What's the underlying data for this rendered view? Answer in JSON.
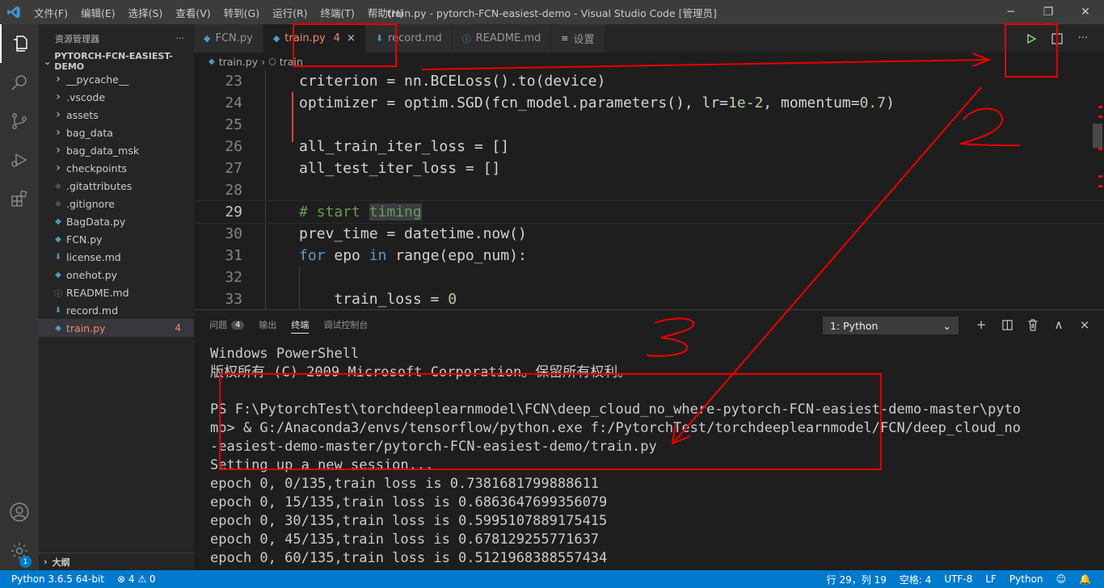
{
  "titlebar": {
    "menu": [
      "文件(F)",
      "编辑(E)",
      "选择(S)",
      "查看(V)",
      "转到(G)",
      "运行(R)",
      "终端(T)",
      "帮助(H)"
    ],
    "window_title": "train.py - pytorch-FCN-easiest-demo - Visual Studio Code [管理员]"
  },
  "activity": {
    "accounts_badge": "1"
  },
  "sidebar": {
    "header": "资源管理器",
    "more": "···",
    "project": "PYTORCH-FCN-EASIEST-DEMO",
    "items": [
      {
        "label": "__pycache__",
        "icon": "chevron-right-icon",
        "glyph": "›",
        "indent": 1
      },
      {
        "label": ".vscode",
        "icon": "chevron-right-icon",
        "glyph": "›",
        "indent": 1
      },
      {
        "label": "assets",
        "icon": "chevron-right-icon",
        "glyph": "›",
        "indent": 1
      },
      {
        "label": "bag_data",
        "icon": "chevron-right-icon",
        "glyph": "›",
        "indent": 1
      },
      {
        "label": "bag_data_msk",
        "icon": "chevron-right-icon",
        "glyph": "›",
        "indent": 1
      },
      {
        "label": "checkpoints",
        "icon": "chevron-right-icon",
        "glyph": "›",
        "indent": 1
      },
      {
        "label": ".gitattributes",
        "icon": "git-file-icon",
        "glyph": "◆",
        "indent": 1
      },
      {
        "label": ".gitignore",
        "icon": "git-file-icon",
        "glyph": "◆",
        "indent": 1
      },
      {
        "label": "BagData.py",
        "icon": "python-file-icon",
        "glyph": "◆",
        "indent": 1
      },
      {
        "label": "FCN.py",
        "icon": "python-file-icon",
        "glyph": "◆",
        "indent": 1
      },
      {
        "label": "license.md",
        "icon": "markdown-file-icon",
        "glyph": "⬇",
        "indent": 1
      },
      {
        "label": "onehot.py",
        "icon": "python-file-icon",
        "glyph": "◆",
        "indent": 1
      },
      {
        "label": "README.md",
        "icon": "info-file-icon",
        "glyph": "ⓘ",
        "indent": 1
      },
      {
        "label": "record.md",
        "icon": "markdown-file-icon",
        "glyph": "⬇",
        "indent": 1
      },
      {
        "label": "train.py",
        "icon": "python-file-icon",
        "glyph": "◆",
        "indent": 1,
        "selected": true,
        "count": "4"
      }
    ],
    "outline": "大纲"
  },
  "tabs": [
    {
      "label": "FCN.py",
      "icon": "python-file-icon",
      "glyph": "◆"
    },
    {
      "label": "train.py",
      "icon": "python-file-icon",
      "glyph": "◆",
      "active": true,
      "badge": "4",
      "close": "×"
    },
    {
      "label": "record.md",
      "icon": "markdown-file-icon",
      "glyph": "⬇"
    },
    {
      "label": "README.md",
      "icon": "info-file-icon",
      "glyph": "ⓘ"
    },
    {
      "label": "设置",
      "icon": "settings-file-icon",
      "glyph": "≡"
    }
  ],
  "tab_actions": {
    "run": "▷",
    "split": "◫",
    "more": "···"
  },
  "breadcrumb": {
    "file": "train.py",
    "symbol": "train"
  },
  "code": {
    "lines": [
      {
        "n": "23",
        "html": "criterion = nn.BCELoss().to(device)"
      },
      {
        "n": "24",
        "html": "optimizer = optim.SGD(fcn_model.parameters(), lr=<span class=\"num\">1e-2</span>, momentum=<span class=\"num\">0.7</span>)"
      },
      {
        "n": "25",
        "html": ""
      },
      {
        "n": "26",
        "html": "all_train_iter_loss = []"
      },
      {
        "n": "27",
        "html": "all_test_iter_loss = []"
      },
      {
        "n": "28",
        "html": ""
      },
      {
        "n": "29",
        "html": "<span class=\"cm\"># start <span class=\"hl\">timing</span></span>",
        "current": true
      },
      {
        "n": "30",
        "html": "prev_time = datetime.now()"
      },
      {
        "n": "31",
        "html": "<span class=\"kw\">for</span> epo <span class=\"kw\">in</span> range(epo_num):"
      },
      {
        "n": "32",
        "html": ""
      },
      {
        "n": "33",
        "html": "    train_loss = <span class=\"num\">0</span>"
      }
    ]
  },
  "panel": {
    "tabs": [
      {
        "label": "问题",
        "badge": "4"
      },
      {
        "label": "输出"
      },
      {
        "label": "终端",
        "active": true
      },
      {
        "label": "调试控制台"
      }
    ],
    "terminal_select": "1: Python",
    "actions": {
      "add": "+",
      "split": "◫",
      "trash": "🗑",
      "maximize": "∧",
      "close": "×"
    },
    "terminal_lines": [
      "Windows PowerShell",
      "版权所有 (C) 2009 Microsoft Corporation。保留所有权利。",
      "",
      "PS F:\\PytorchTest\\torchdeeplearnmodel\\FCN\\deep_cloud_no_where-pytorch-FCN-easiest-demo-master\\pyto",
      "mo> & G:/Anaconda3/envs/tensorflow/python.exe f:/PytorchTest/torchdeeplearnmodel/FCN/deep_cloud_no",
      "-easiest-demo-master/pytorch-FCN-easiest-demo/train.py",
      "Setting up a new session...",
      "epoch 0, 0/135,train loss is 0.7381681799888611",
      "epoch 0, 15/135,train loss is 0.6863647699356079",
      "epoch 0, 30/135,train loss is 0.5995107889175415",
      "epoch 0, 45/135,train loss is 0.678129255771637",
      "epoch 0, 60/135,train loss is 0.5121968388557434"
    ]
  },
  "statusbar": {
    "interpreter": "Python 3.6.5 64-bit",
    "errors": "⊗ 4 ⚠ 0",
    "position": "行 29，列 19",
    "spaces": "空格: 4",
    "encoding": "UTF-8",
    "eol": "LF",
    "language": "Python"
  },
  "annotations": {
    "color": "#e00000",
    "label_2": "2",
    "label_3": "3"
  }
}
